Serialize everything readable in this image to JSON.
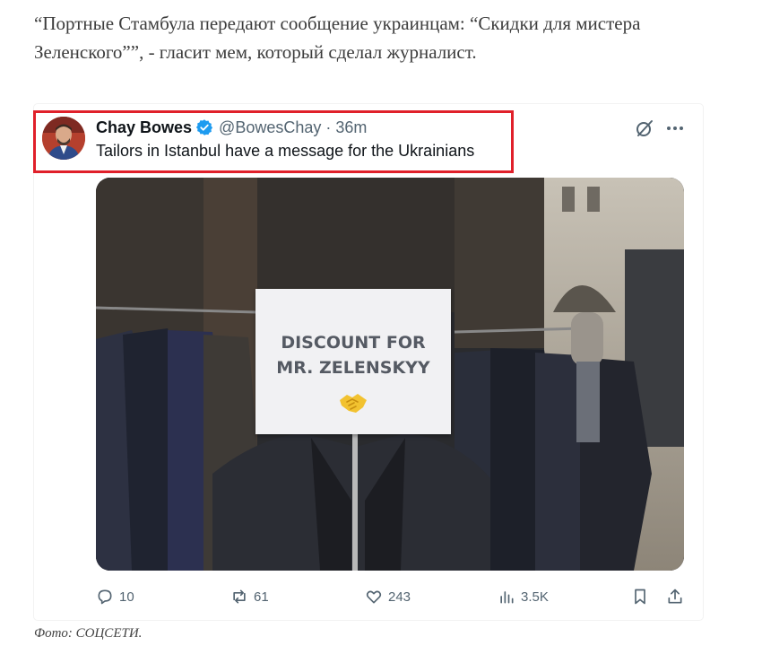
{
  "article": {
    "lead_text": "“Портные Стамбула передают сообщение украинцам: “Скидки для мистера Зеленского””, - гласит мем, который сделал журналист.",
    "photo_caption": "Фото: СОЦСЕТИ."
  },
  "tweet": {
    "author_name": "Chay Bowes",
    "handle_time": "@BowesChay · 36m",
    "text": "Tailors in Istanbul have a message for the Ukrainians",
    "image": {
      "sign_line1": "DISCOUNT FOR",
      "sign_line2": "MR. ZELENSKYY",
      "sign_emoji": "handshake-emoji"
    },
    "stats": {
      "replies": "10",
      "reposts": "61",
      "likes": "243",
      "views": "3.5K"
    },
    "icons": [
      "verified-badge-icon",
      "grok-icon",
      "more-icon",
      "reply-icon",
      "repost-icon",
      "like-icon",
      "views-icon",
      "bookmark-icon",
      "share-icon"
    ],
    "colors": {
      "highlight_border": "#e0202a",
      "verified_blue": "#1d9bf0",
      "text_primary": "#0f1419",
      "text_secondary": "#536471"
    }
  }
}
